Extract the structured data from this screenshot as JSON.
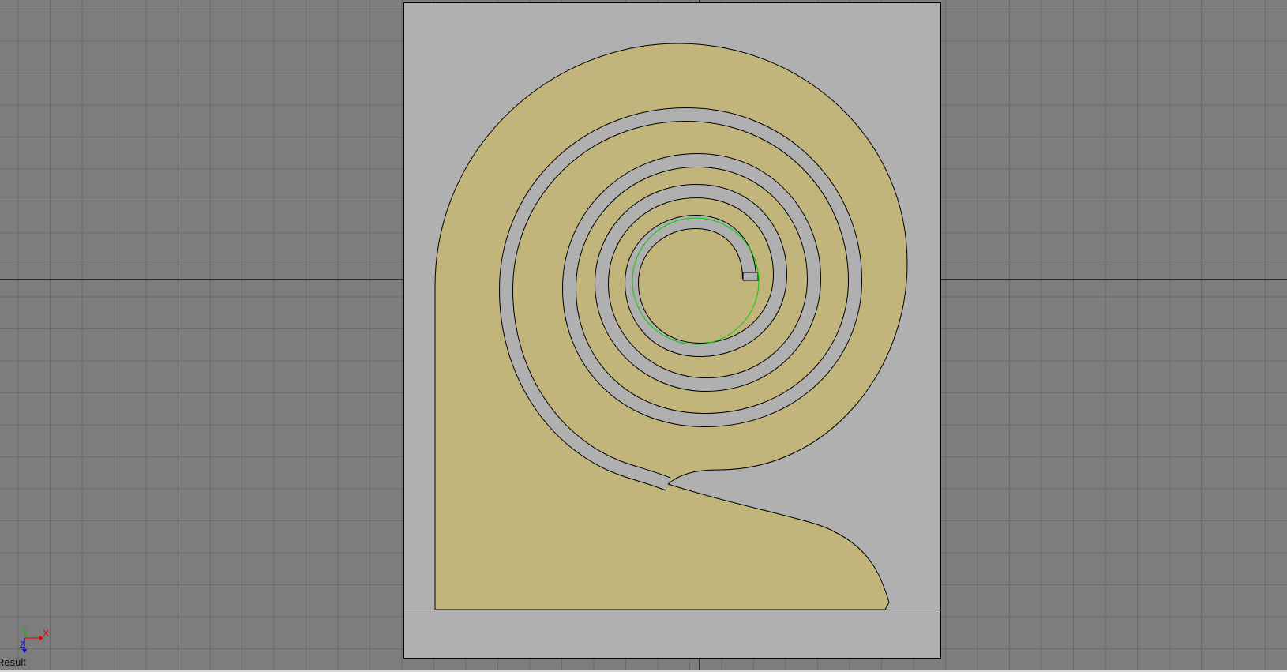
{
  "viewport": {
    "name": "Result",
    "background_color": "#7d7d7d",
    "grid_color": "#6a6a6a",
    "main_axis_color": "#2e2e2e"
  },
  "gizmo": {
    "y_label": "Y",
    "x_label": "X",
    "z_label": "Z",
    "y_color": "#00c000",
    "x_color": "#e00000",
    "z_color": "#0000e0"
  },
  "scene": {
    "panel_color": "#b0b0b0",
    "shape_color": "#c2b57b",
    "outline_color": "#000000",
    "highlight_color": "#00d000"
  }
}
